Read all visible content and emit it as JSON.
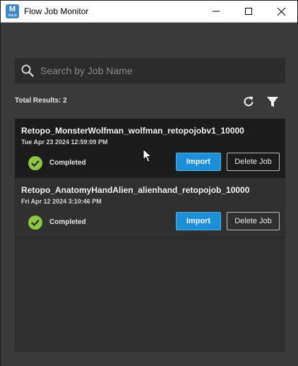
{
  "window": {
    "title": "Flow Job Monitor",
    "app_icon_letter": "M",
    "app_icon_sub": "maya"
  },
  "search": {
    "placeholder": "Search by Job Name",
    "value": ""
  },
  "results": {
    "label": "Total Results: 2"
  },
  "jobs": [
    {
      "name": "Retopo_MonsterWolfman_wolfman_retopojobv1_10000",
      "date": "Tue Apr 23 2024 12:59:09 PM",
      "status": "Completed",
      "import_label": "Import",
      "delete_label": "Delete Job",
      "selected": true
    },
    {
      "name": "Retopo_AnatomyHandAlien_alienhand_retopojob_10000",
      "date": "Fri Apr 12 2024 3:10:46 PM",
      "status": "Completed",
      "import_label": "Import",
      "delete_label": "Delete Job",
      "selected": false
    }
  ],
  "colors": {
    "accent": "#1b8fd8",
    "success": "#8cc63f",
    "background": "#3a3a3a"
  },
  "icons": {
    "search": "search-icon",
    "refresh": "refresh-icon",
    "filter": "filter-icon",
    "status": "check-circle-icon"
  }
}
